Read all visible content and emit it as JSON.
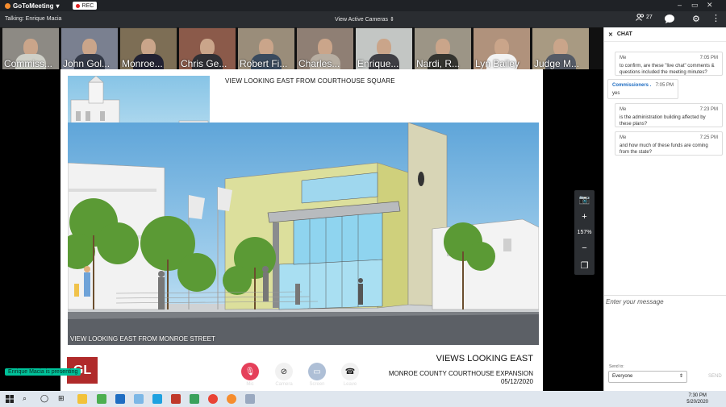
{
  "app": {
    "name": "GoToMeeting",
    "rec_label": "REC"
  },
  "subbar": {
    "talking": "Talking: Enrique Macia",
    "view_cameras": "View Active Cameras",
    "attendee_count": "27"
  },
  "cameras": [
    {
      "name": "Commiss..."
    },
    {
      "name": "John Gol..."
    },
    {
      "name": "Monroe..."
    },
    {
      "name": "Chris Ge..."
    },
    {
      "name": "Robert Fi..."
    },
    {
      "name": "Charles..."
    },
    {
      "name": "Enrique..."
    },
    {
      "name": "Nardi, R..."
    },
    {
      "name": "Lyn Bailey"
    },
    {
      "name": "Judge M..."
    }
  ],
  "slide": {
    "title": "VIEW LOOKING EAST FROM COURTHOUSE SQUARE",
    "caption": "VIEW LOOKING EAST FROM MONROE STREET",
    "logo": "GL",
    "views_title": "VIEWS LOOKING EAST",
    "project": "MONROE COUNTY COURTHOUSE EXPANSION",
    "date": "05/12/2020"
  },
  "rail": {
    "zoom": "157%"
  },
  "presenter": "Enrique Macia is presenting",
  "controls": [
    {
      "label": "Mic"
    },
    {
      "label": "Camera"
    },
    {
      "label": "Screen"
    },
    {
      "label": "Leave"
    }
  ],
  "chat": {
    "title": "CHAT",
    "messages": [
      {
        "who": "Me",
        "time": "7:05 PM",
        "body": "to confirm, are these \"live chat\" comments & questions included the meeting minutes?"
      },
      {
        "who": "Commissioners .",
        "time": "7:05 PM",
        "body": "yes"
      },
      {
        "who": "Me",
        "time": "7:23 PM",
        "body": "is the administration building affected by these plans?"
      },
      {
        "who": "Me",
        "time": "7:25 PM",
        "body": "and how much of these funds are coming from the state?"
      }
    ],
    "input_placeholder": "Enter your message",
    "send_to_label": "Send to:",
    "send_to_value": "Everyone",
    "send_label": "SEND"
  },
  "taskbar": {
    "time": "7:30 PM",
    "date": "5/20/2020"
  },
  "colors": {
    "accent": "#00c29a",
    "rec": "#e02020",
    "logo": "#b02a2a",
    "chat_link": "#1f6dc2"
  }
}
